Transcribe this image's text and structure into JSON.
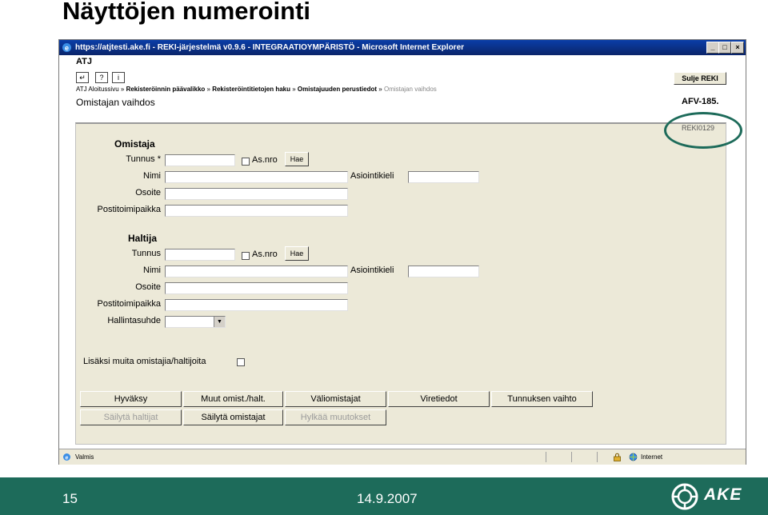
{
  "slide": {
    "title": "Näyttöjen numerointi",
    "page_number": "15",
    "date": "14.9.2007",
    "logo_text": "AKE",
    "footer_color": "#1d6b5a",
    "highlight_color": "#1d6b5a"
  },
  "browser": {
    "title": "https://atjtesti.ake.fi - REKI-järjestelmä v0.9.6 - INTEGRAATIOYMPÄRISTÖ - Microsoft Internet Explorer",
    "controls": {
      "minimize": "_",
      "maximize": "□",
      "close": "×"
    },
    "status_text": "Valmis",
    "zone": "Internet"
  },
  "app": {
    "name": "ATJ",
    "toolbar": {
      "back_icon": "back-arrow-icon",
      "help": "?",
      "info": "i"
    },
    "close_label": "Sulje REKI",
    "breadcrumb": [
      "ATJ Aloitussivu",
      "Rekisteröinnin päävalikko",
      "Rekisteröintitietojen haku",
      "Omistajuuden perustiedot",
      "Omistajan vaihdos"
    ],
    "breadcrumb_sep": "»",
    "page_heading": "Omistajan vaihdos",
    "vehicle_id": "AFV-185.",
    "screen_code": "REKI0129"
  },
  "form": {
    "owner": {
      "title": "Omistaja",
      "id_label": "Tunnus *",
      "asnro_label": "As.nro",
      "search_label": "Hae",
      "name_label": "Nimi",
      "agent_label": "Asiointikieli",
      "address_label": "Osoite",
      "postal_label": "Postitoimipaikka"
    },
    "holder": {
      "title": "Haltija",
      "id_label": "Tunnus",
      "asnro_label": "As.nro",
      "search_label": "Hae",
      "name_label": "Nimi",
      "agent_label": "Asiointikieli",
      "address_label": "Osoite",
      "postal_label": "Postitoimipaikka",
      "relation_label": "Hallintasuhde",
      "relation_value": ""
    },
    "more_label": "Lisäksi muita omistajia/haltijoita"
  },
  "buttons": {
    "accept": "Hyväksy",
    "other": "Muut omist./halt.",
    "intermediate": "Väliomistajat",
    "official": "Viretiedot",
    "id_change": "Tunnuksen vaihto",
    "save_holders": "Säilytä haltijat",
    "save_owners": "Säilytä omistajat",
    "reject": "Hylkää muutokset"
  }
}
